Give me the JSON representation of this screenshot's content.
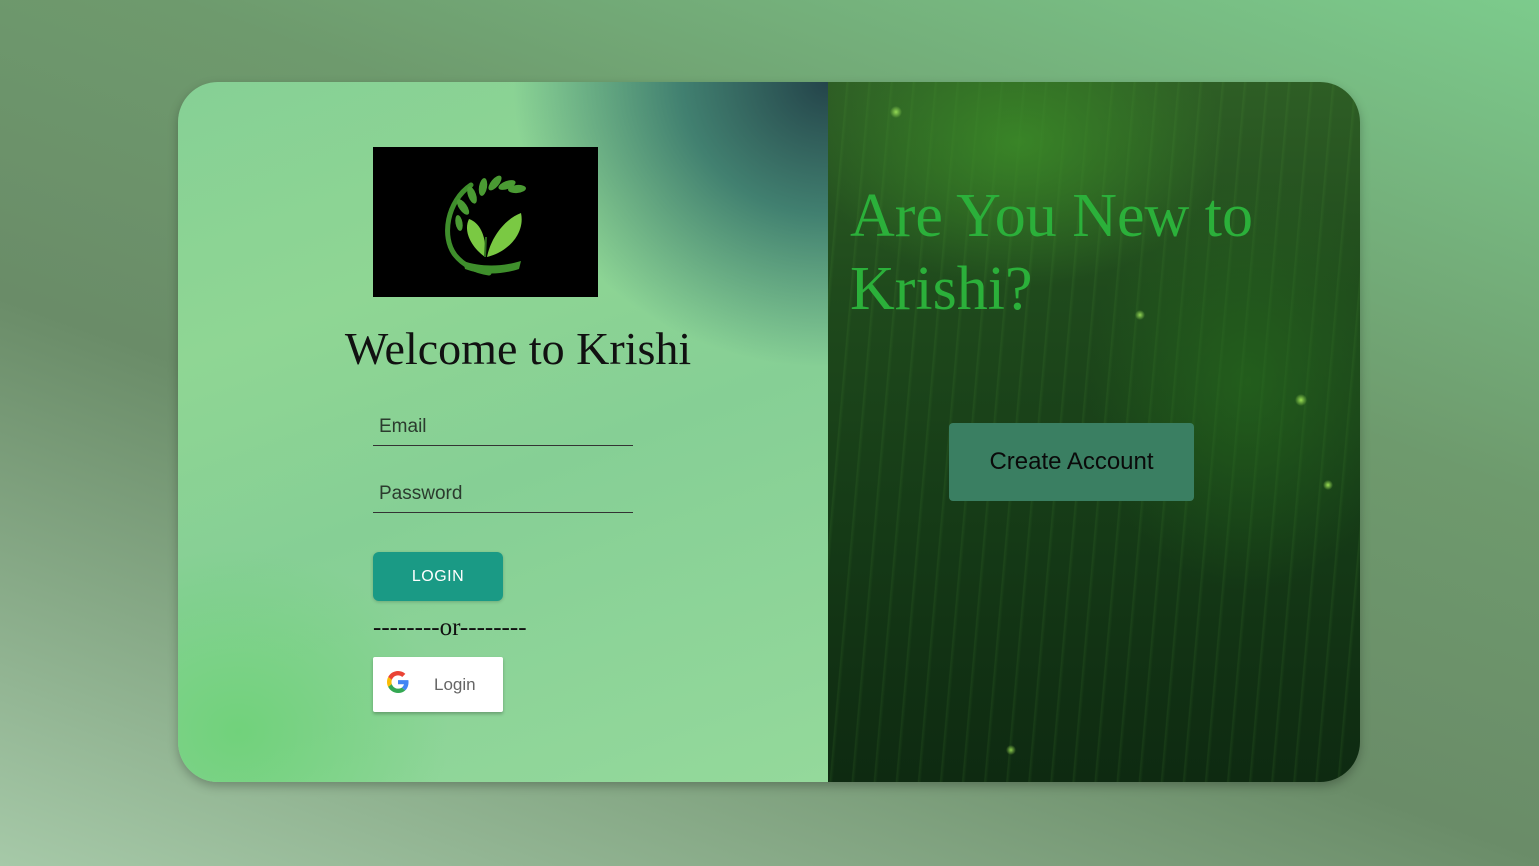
{
  "login_panel": {
    "logo_icon": "krishi-plant-logo",
    "welcome_title": "Welcome to Krishi",
    "email_placeholder": "Email",
    "password_placeholder": "Password",
    "login_button": "LOGIN",
    "separator": "--------or--------",
    "google_button_label": "Login",
    "google_icon": "google-g-icon"
  },
  "signup_panel": {
    "title": "Are You New to Krishi?",
    "create_account_button": "Create Account"
  },
  "colors": {
    "login_button": "#1a9a85",
    "create_account_button": "#3a7f62",
    "title_green": "#2bb03a"
  }
}
